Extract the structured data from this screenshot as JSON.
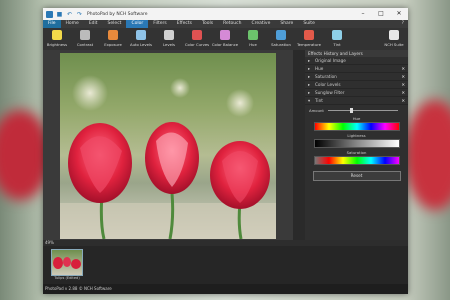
{
  "window": {
    "title": "PhotoPad by NCH Software"
  },
  "menu": {
    "items": [
      {
        "label": "File",
        "active": true
      },
      {
        "label": "Home"
      },
      {
        "label": "Edit"
      },
      {
        "label": "Select"
      },
      {
        "label": "Color",
        "blue": true
      },
      {
        "label": "Filters"
      },
      {
        "label": "Effects"
      },
      {
        "label": "Tools"
      },
      {
        "label": "Retouch"
      },
      {
        "label": "Creative"
      },
      {
        "label": "Share"
      },
      {
        "label": "Suite"
      }
    ]
  },
  "toolbar": {
    "buttons": [
      {
        "label": "Brightness",
        "icon": "brightness-icon",
        "color": "#f2d94a"
      },
      {
        "label": "Contrast",
        "icon": "contrast-icon",
        "color": "#bbbbbb"
      },
      {
        "label": "Exposure",
        "icon": "exposure-icon",
        "color": "#e88a3c"
      },
      {
        "label": "Auto Levels",
        "icon": "auto-levels-icon",
        "color": "#8fc3e8"
      },
      {
        "label": "Levels",
        "icon": "levels-icon",
        "color": "#d0d0d0"
      },
      {
        "label": "Color Curves",
        "icon": "color-curves-icon",
        "color": "#e05252"
      },
      {
        "label": "Color Balance",
        "icon": "color-balance-icon",
        "color": "#d58ad6"
      },
      {
        "label": "Hue",
        "icon": "hue-icon",
        "color": "#6cc36c"
      },
      {
        "label": "Saturation",
        "icon": "saturation-icon",
        "color": "#4f9ed8"
      },
      {
        "label": "Temperature",
        "icon": "temperature-icon",
        "color": "#e25a4a"
      },
      {
        "label": "Tint",
        "icon": "tint-icon",
        "color": "#8fd0e8"
      },
      {
        "label": "NCH Suite",
        "icon": "nch-suite-icon",
        "color": "#e8e8e8"
      }
    ]
  },
  "panel": {
    "header": "Effects History and Layers",
    "layers": [
      {
        "label": "Original Image",
        "closable": false
      },
      {
        "label": "Hue",
        "closable": true
      },
      {
        "label": "Saturation",
        "closable": true
      },
      {
        "label": "Color Levels",
        "closable": true
      },
      {
        "label": "Sunglow Filter",
        "closable": true
      },
      {
        "label": "Tint",
        "closable": true,
        "open": true
      }
    ],
    "amount_label": "Amount",
    "hue_label": "Hue",
    "lightness_label": "Lightness",
    "saturation_label": "Saturation",
    "reset_label": "Reset"
  },
  "status": {
    "zoom": "49%",
    "bottom": "PhotoPad v 2.88 © NCH Software"
  },
  "thumbnail": {
    "label": "Tulips (Edited)"
  }
}
